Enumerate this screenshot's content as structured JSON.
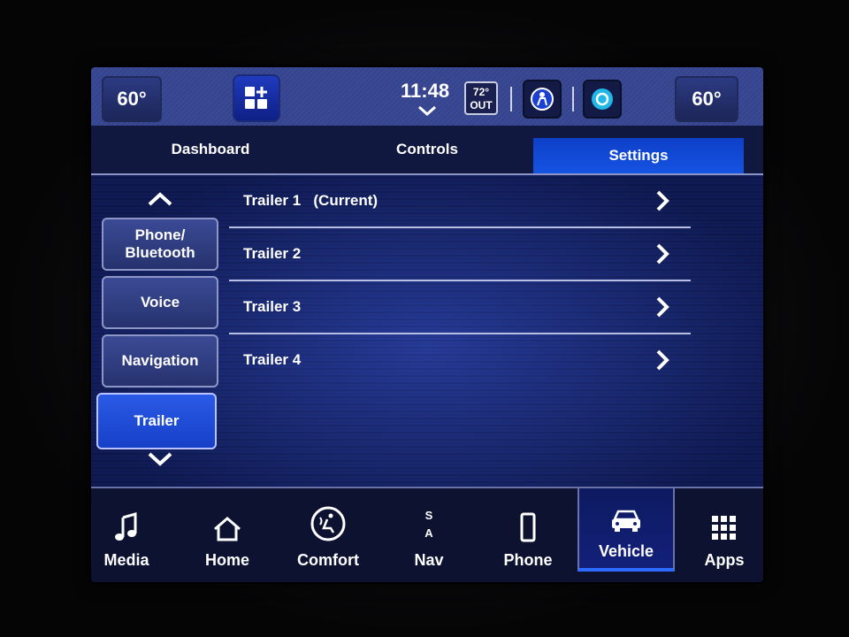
{
  "statusbar": {
    "temp_left": "60°",
    "temp_right": "60°",
    "time": "11:48",
    "outside_temp": "72°",
    "outside_label": "OUT"
  },
  "tabs": [
    {
      "label": "Dashboard",
      "active": false
    },
    {
      "label": "Controls",
      "active": false
    },
    {
      "label": "Settings",
      "active": true
    }
  ],
  "sidebar": {
    "items": [
      {
        "label": "Phone/\nBluetooth"
      },
      {
        "label": "Voice"
      },
      {
        "label": "Navigation"
      },
      {
        "label": "Trailer",
        "active": true
      }
    ]
  },
  "trailers": [
    {
      "label": "Trailer 1   (Current)"
    },
    {
      "label": "Trailer 2"
    },
    {
      "label": "Trailer 3"
    },
    {
      "label": "Trailer 4"
    }
  ],
  "bottomnav": {
    "media": "Media",
    "home": "Home",
    "comfort": "Comfort",
    "nav": "Nav",
    "nav_compass_top": "S",
    "nav_compass_bottom": "A",
    "phone": "Phone",
    "vehicle": "Vehicle",
    "apps": "Apps",
    "active": "Vehicle"
  },
  "colors": {
    "accent": "#1554e2",
    "statusbar": "#3a4a96",
    "background": "#142270"
  }
}
